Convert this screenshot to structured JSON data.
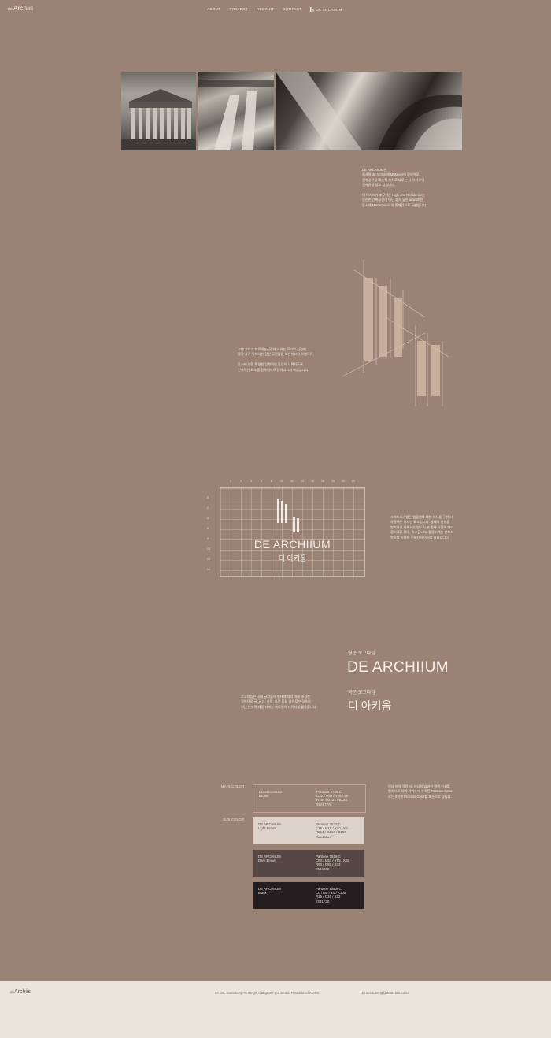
{
  "header": {
    "logo_prefix": "de",
    "logo_text": "Archiis",
    "nav": [
      "ABOUT",
      "PROJECT",
      "RECRUIT",
      "CONTACT"
    ],
    "brand": "DE ARCHIIUM"
  },
  "intro": {
    "lines": [
      "DE ARCHIIUM은",
      "회사명 de Archiis에 Museum이 합성어로,",
      "건축공간을 예술적 가치로 다루는 디 아키으의",
      "건축관을 담고 있습니다.",
      "",
      "디 아키즈가 추구하는 High-end Residence는",
      "단순한 건축공간이 아닌 품격 높은 artwork인",
      "동시에 Masterpiece 의 존재감으로 구현됩니다."
    ]
  },
  "concept": {
    "lines": [
      "고대 그리스 파르테논신전에 쓰이는 모티브 신전에",
      "웅장 사각 뒤에서는 갈한 공간감을 표현하고자 하였으며,",
      "",
      "동시에 엔틀 활용한 입체적인 공간이 느껴지도록",
      "건축적인 요소를 함축적으로 담아내고자 하였습니다."
    ]
  },
  "grid": {
    "x_ticks": [
      "0",
      "2",
      "4",
      "6",
      "8",
      "10",
      "12",
      "14",
      "16",
      "18",
      "20",
      "22",
      "24"
    ],
    "y_ticks": [
      "0",
      "2",
      "4",
      "6",
      "8",
      "10",
      "12",
      "14"
    ],
    "logo_en": "DE ARCHIIUM",
    "logo_kr": "디 아키움",
    "lines": [
      "그리드시스템은 엠블렘의 대형 제작을 구현 시",
      "사용하는 디자인 요소입니다. 형태의 변형을",
      "방지하기 위해서는 반드시 본 형태 규정에 따라",
      "정비례로 확대, 축소합니다. 활용시에는 반드시",
      "원고를 이용해 수록된 데이터를 활용합니다."
    ]
  },
  "logotype": {
    "en_label": "영문 로고타입",
    "en": "DE ARCHIIUM",
    "kr_label": "국문 로고타입",
    "kr": "디 아키움",
    "lines": [
      "로고타입은 국내 글자들의 형태에 따라 마테 조정한",
      "것이므로 굵, 굵기, 자폭, 자간 등을 임의로 변경하여",
      "서는 안되며 제공 시에는 제도원의 데이터를 활용합니다."
    ]
  },
  "colors": {
    "main_label": "MAIN COLOR",
    "sub_label": "SUB COLOR",
    "swatches": [
      {
        "name1": "DE ARCHIIUM",
        "name2": "Brown",
        "v1": "Pantone 4725 C",
        "v2": "C32 / M39 / Y45 / 20",
        "v3": "R154 / G131 / B124",
        "v4": "#9A877A",
        "color": "#9a8375"
      },
      {
        "name1": "DE ARCHIIUM",
        "name2": "Light Brown",
        "v1": "Pantone 7527 C",
        "v2": "C15 / M15 / Y20 / K0",
        "v3": "R214 / G210 / B196",
        "v4": "#DCD2C4",
        "color": "#dcd2ca"
      },
      {
        "name1": "DE ARCHIIUM",
        "name2": "Dark Brown",
        "v1": "Pantone 7519 C",
        "v2": "C50 / M52 / Y55 / K50",
        "v3": "R90 / G80 / B73",
        "v4": "#534943",
        "color": "#554743"
      },
      {
        "name1": "DE ARCHIIUM",
        "name2": "Black",
        "v1": "Pantone Black C",
        "v2": "C0 / M0 / Y0 / K100",
        "v3": "R35 / G31 / B32",
        "v4": "#231F20",
        "color": "#231f20"
      }
    ],
    "lines": [
      "인쇄 매체 적용 시, 색상의 효과한 명색 인쇄를",
      "원칙으로 하며 가이드에 수록된 Pantone Color",
      "또는 4원색 Process Color를 표준으로 합니다."
    ]
  },
  "footer": {
    "logo_prefix": "de",
    "logo_text": "Archiis",
    "address": "5F, 35, Samseong-ro 95-gil, Gangnam-gu, Seoul, Republic of Korea",
    "email": "(E) accounting@dearchiis.co.kr"
  }
}
